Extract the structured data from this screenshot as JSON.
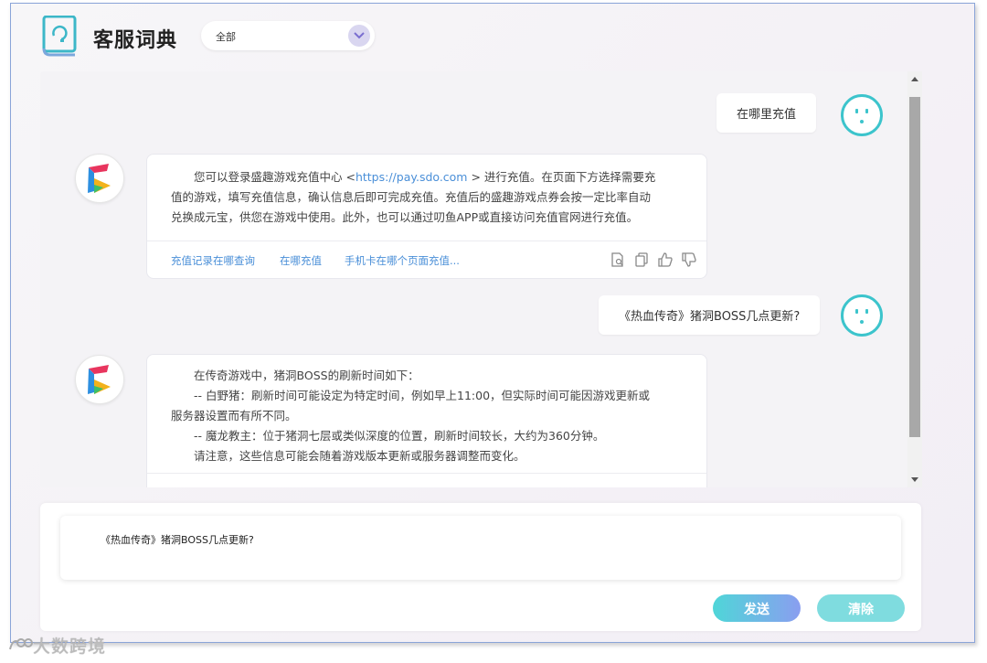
{
  "header": {
    "title": "客服词典",
    "filter_value": "全部"
  },
  "conversation": {
    "q1": "在哪里充值",
    "a1": {
      "line1_before": "您可以登录盛趣游戏充值中心 <",
      "link": "https://pay.sdo.com",
      "line1_after": " > 进行充值。在页面下方选择需要充",
      "line2": "值的游戏，填写充值信息，确认信息后即可完成充值。充值后的盛趣游戏点券会按一定比率自动",
      "line3": "兑换成元宝，供您在游戏中使用。此外，也可以通过叨鱼APP或直接访问充值官网进行充值。",
      "related": [
        "充值记录在哪查询",
        "在哪充值",
        "手机卡在哪个页面充值..."
      ]
    },
    "q2": "《热血传奇》猪洞BOSS几点更新?",
    "a2": {
      "lines": [
        "在传奇游戏中，猪洞BOSS的刷新时间如下：",
        "-- 白野猪：刷新时间可能设定为特定时间，例如早上11:00，但实际时间可能因游戏更新或",
        "服务器设置而有所不同。",
        "-- 魔龙教主：位于猪洞七层或类似深度的位置，刷新时间较长，大约为360分钟。",
        "请注意，这些信息可能会随着游戏版本更新或服务器调整而变化。"
      ]
    }
  },
  "input": {
    "value": "《热血传奇》猪洞BOSS几点更新?"
  },
  "buttons": {
    "send": "发送",
    "clear": "清除"
  },
  "watermark": "大数跨境",
  "colors": {
    "accent": "#3cc4cc",
    "link": "#4a8fd8",
    "send_start": "#4fd6d8",
    "send_end": "#8a9ef0"
  }
}
